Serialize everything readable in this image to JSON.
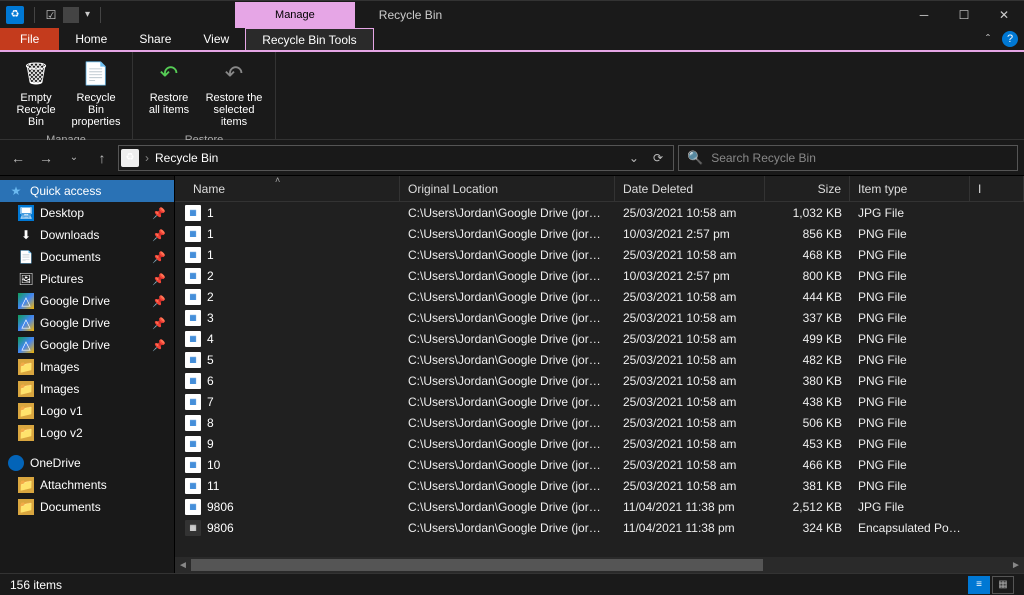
{
  "titlebar": {
    "contextual_tab": "Manage",
    "window_title": "Recycle Bin"
  },
  "ribbon_tabs": {
    "file": "File",
    "home": "Home",
    "share": "Share",
    "view": "View",
    "tools": "Recycle Bin Tools"
  },
  "ribbon": {
    "empty": "Empty Recycle Bin",
    "properties": "Recycle Bin properties",
    "manage_group": "Manage",
    "restore_all": "Restore all items",
    "restore_selected": "Restore the selected items",
    "restore_group": "Restore"
  },
  "address": {
    "path": "Recycle Bin"
  },
  "search": {
    "placeholder": "Search Recycle Bin"
  },
  "columns": {
    "name": "Name",
    "original_location": "Original Location",
    "date_deleted": "Date Deleted",
    "size": "Size",
    "item_type": "Item type"
  },
  "sidebar": {
    "quick_access": "Quick access",
    "items": [
      {
        "label": "Desktop",
        "icon": "desktop",
        "pin": true
      },
      {
        "label": "Downloads",
        "icon": "download",
        "pin": true
      },
      {
        "label": "Documents",
        "icon": "doc",
        "pin": true
      },
      {
        "label": "Pictures",
        "icon": "pic",
        "pin": true
      },
      {
        "label": "Google Drive",
        "icon": "gd",
        "pin": true
      },
      {
        "label": "Google Drive",
        "icon": "gd",
        "pin": true
      },
      {
        "label": "Google Drive",
        "icon": "gd",
        "pin": true
      },
      {
        "label": "Images",
        "icon": "folder",
        "pin": false
      },
      {
        "label": "Images",
        "icon": "folder",
        "pin": false
      },
      {
        "label": "Logo v1",
        "icon": "folder",
        "pin": false
      },
      {
        "label": "Logo v2",
        "icon": "folder",
        "pin": false
      }
    ],
    "onedrive": "OneDrive",
    "od_items": [
      {
        "label": "Attachments"
      },
      {
        "label": "Documents"
      }
    ]
  },
  "files": [
    {
      "name": "1",
      "loc": "C:\\Users\\Jordan\\Google Drive (jordan@j...",
      "date": "25/03/2021 10:58 am",
      "size": "1,032 KB",
      "type": "JPG File",
      "ico": "img"
    },
    {
      "name": "1",
      "loc": "C:\\Users\\Jordan\\Google Drive (jordan@j...",
      "date": "10/03/2021 2:57 pm",
      "size": "856 KB",
      "type": "PNG File",
      "ico": "img"
    },
    {
      "name": "1",
      "loc": "C:\\Users\\Jordan\\Google Drive (jordan@j...",
      "date": "25/03/2021 10:58 am",
      "size": "468 KB",
      "type": "PNG File",
      "ico": "img"
    },
    {
      "name": "2",
      "loc": "C:\\Users\\Jordan\\Google Drive (jordan@j...",
      "date": "10/03/2021 2:57 pm",
      "size": "800 KB",
      "type": "PNG File",
      "ico": "img"
    },
    {
      "name": "2",
      "loc": "C:\\Users\\Jordan\\Google Drive (jordan@j...",
      "date": "25/03/2021 10:58 am",
      "size": "444 KB",
      "type": "PNG File",
      "ico": "img"
    },
    {
      "name": "3",
      "loc": "C:\\Users\\Jordan\\Google Drive (jordan@j...",
      "date": "25/03/2021 10:58 am",
      "size": "337 KB",
      "type": "PNG File",
      "ico": "img"
    },
    {
      "name": "4",
      "loc": "C:\\Users\\Jordan\\Google Drive (jordan@j...",
      "date": "25/03/2021 10:58 am",
      "size": "499 KB",
      "type": "PNG File",
      "ico": "img"
    },
    {
      "name": "5",
      "loc": "C:\\Users\\Jordan\\Google Drive (jordan@j...",
      "date": "25/03/2021 10:58 am",
      "size": "482 KB",
      "type": "PNG File",
      "ico": "img"
    },
    {
      "name": "6",
      "loc": "C:\\Users\\Jordan\\Google Drive (jordan@j...",
      "date": "25/03/2021 10:58 am",
      "size": "380 KB",
      "type": "PNG File",
      "ico": "img"
    },
    {
      "name": "7",
      "loc": "C:\\Users\\Jordan\\Google Drive (jordan@j...",
      "date": "25/03/2021 10:58 am",
      "size": "438 KB",
      "type": "PNG File",
      "ico": "img"
    },
    {
      "name": "8",
      "loc": "C:\\Users\\Jordan\\Google Drive (jordan@j...",
      "date": "25/03/2021 10:58 am",
      "size": "506 KB",
      "type": "PNG File",
      "ico": "img"
    },
    {
      "name": "9",
      "loc": "C:\\Users\\Jordan\\Google Drive (jordan@j...",
      "date": "25/03/2021 10:58 am",
      "size": "453 KB",
      "type": "PNG File",
      "ico": "img"
    },
    {
      "name": "10",
      "loc": "C:\\Users\\Jordan\\Google Drive (jordan@j...",
      "date": "25/03/2021 10:58 am",
      "size": "466 KB",
      "type": "PNG File",
      "ico": "img"
    },
    {
      "name": "11",
      "loc": "C:\\Users\\Jordan\\Google Drive (jordan@j...",
      "date": "25/03/2021 10:58 am",
      "size": "381 KB",
      "type": "PNG File",
      "ico": "img"
    },
    {
      "name": "9806",
      "loc": "C:\\Users\\Jordan\\Google Drive (jordan@j...",
      "date": "11/04/2021 11:38 pm",
      "size": "2,512 KB",
      "type": "JPG File",
      "ico": "img"
    },
    {
      "name": "9806",
      "loc": "C:\\Users\\Jordan\\Google Drive (jordan@j...",
      "date": "11/04/2021 11:38 pm",
      "size": "324 KB",
      "type": "Encapsulated Post...",
      "ico": "eps"
    }
  ],
  "status": {
    "count": "156 items"
  }
}
